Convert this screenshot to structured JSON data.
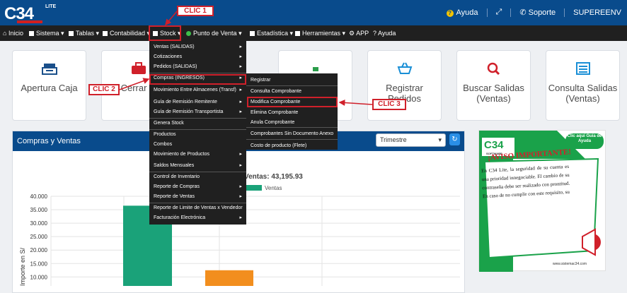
{
  "topbar": {
    "logo": "C34",
    "logo_suffix": "LITE",
    "ayuda": "Ayuda",
    "soporte": "Soporte",
    "user": "SUPEREENV"
  },
  "nav": {
    "items": [
      {
        "label": "Inicio"
      },
      {
        "label": "Sistema"
      },
      {
        "label": "Tablas"
      },
      {
        "label": "Contabilidad"
      },
      {
        "label": "Stock"
      },
      {
        "label": "Punto de Venta"
      },
      {
        "label": "Estadística"
      },
      {
        "label": "Herramientas"
      },
      {
        "label": "APP"
      },
      {
        "label": "Ayuda"
      }
    ]
  },
  "cards": [
    {
      "label": "Apertura Caja",
      "icon": "cash-register-icon",
      "color": "#1a4f8a"
    },
    {
      "label": "Cerrar C",
      "icon": "briefcase-icon",
      "color": "#d0202a"
    },
    {
      "label": "",
      "icon": "people-icon",
      "color": "#2a9d4a"
    },
    {
      "label": "Registrar Pedidos",
      "icon": "basket-icon",
      "color": "#1a8fd6"
    },
    {
      "label": "Buscar Salidas (Ventas)",
      "icon": "search-icon",
      "color": "#d0202a"
    },
    {
      "label": "Consulta Salidas (Ventas)",
      "icon": "list-icon",
      "color": "#1a8fd6"
    }
  ],
  "panel": {
    "title": "Compras y Ventas",
    "select_value": "Trimestre",
    "subtitle": "Ventas: 43,195.93"
  },
  "chart_data": {
    "type": "bar",
    "ylabel": "Importe en S/",
    "yticks": [
      "40.000",
      "35.000",
      "30.000",
      "25.000",
      "20.000",
      "15.000",
      "10.000"
    ],
    "ylim": [
      10000,
      40000
    ],
    "series": [
      {
        "name": "Ventas",
        "values": [
          36500
        ],
        "color": "#1aa279"
      },
      {
        "name": "",
        "values": [
          12500
        ],
        "color": "#f28e1e"
      }
    ],
    "legend": "Ventas",
    "grid": true
  },
  "stock_menu": {
    "items": [
      {
        "label": "Ventas (SALIDAS)",
        "arrow": true
      },
      {
        "label": "Cotizaciones",
        "arrow": true
      },
      {
        "label": "Pedidos (SALIDAS)",
        "arrow": true
      },
      {
        "label": "Compras (INGRESOS)",
        "arrow": true
      },
      {
        "label": "Movimiento Entre Almacenes (Transf)",
        "arrow": true
      },
      {
        "label": "Guía de Remisión Remitente",
        "arrow": true
      },
      {
        "label": "Guía de Remisión Transportista",
        "arrow": true
      },
      {
        "label": "Genera Stock",
        "arrow": false
      },
      {
        "label": "Productos",
        "arrow": false
      },
      {
        "label": "Combos",
        "arrow": false
      },
      {
        "label": "Movimiento de Productos",
        "arrow": true
      },
      {
        "label": "Saldos Mensuales",
        "arrow": true
      },
      {
        "label": "Control de Inventario",
        "arrow": false
      },
      {
        "label": "Reporte de Compras",
        "arrow": true
      },
      {
        "label": "Reporte de Ventas",
        "arrow": true
      },
      {
        "label": "Reporte de Limite de Ventas x Vendedor",
        "arrow": false
      },
      {
        "label": "Facturación Electrónica",
        "arrow": true
      }
    ]
  },
  "compras_submenu": {
    "items": [
      {
        "label": "Registrar"
      },
      {
        "label": "Consulta Comprobante"
      },
      {
        "label": "Modifica Comprobante"
      },
      {
        "label": "Elimina Comprobante"
      },
      {
        "label": "Anula Comprobante"
      },
      {
        "label": "Comprobantes Sin Documento Anexo"
      },
      {
        "label": "Costo de producto (Flete)"
      }
    ]
  },
  "callouts": {
    "clic1": "CLIC 1",
    "clic2": "CLIC 2",
    "clic3": "CLIC 3"
  },
  "promo": {
    "brand": "C34",
    "brand_sub": "SOFTWARE",
    "help_link": "Clic aquí Guía de Ayuda",
    "headline": "¡AVISO IMPORTANTE!",
    "body": "En C34 Lite, la seguridad de su cuenta es una prioridad innegociable. El cambio de su contraseña debe ser realizado con prontitud. En caso de no cumplir con este requisito, su",
    "website": "www.sistemac34.com"
  }
}
